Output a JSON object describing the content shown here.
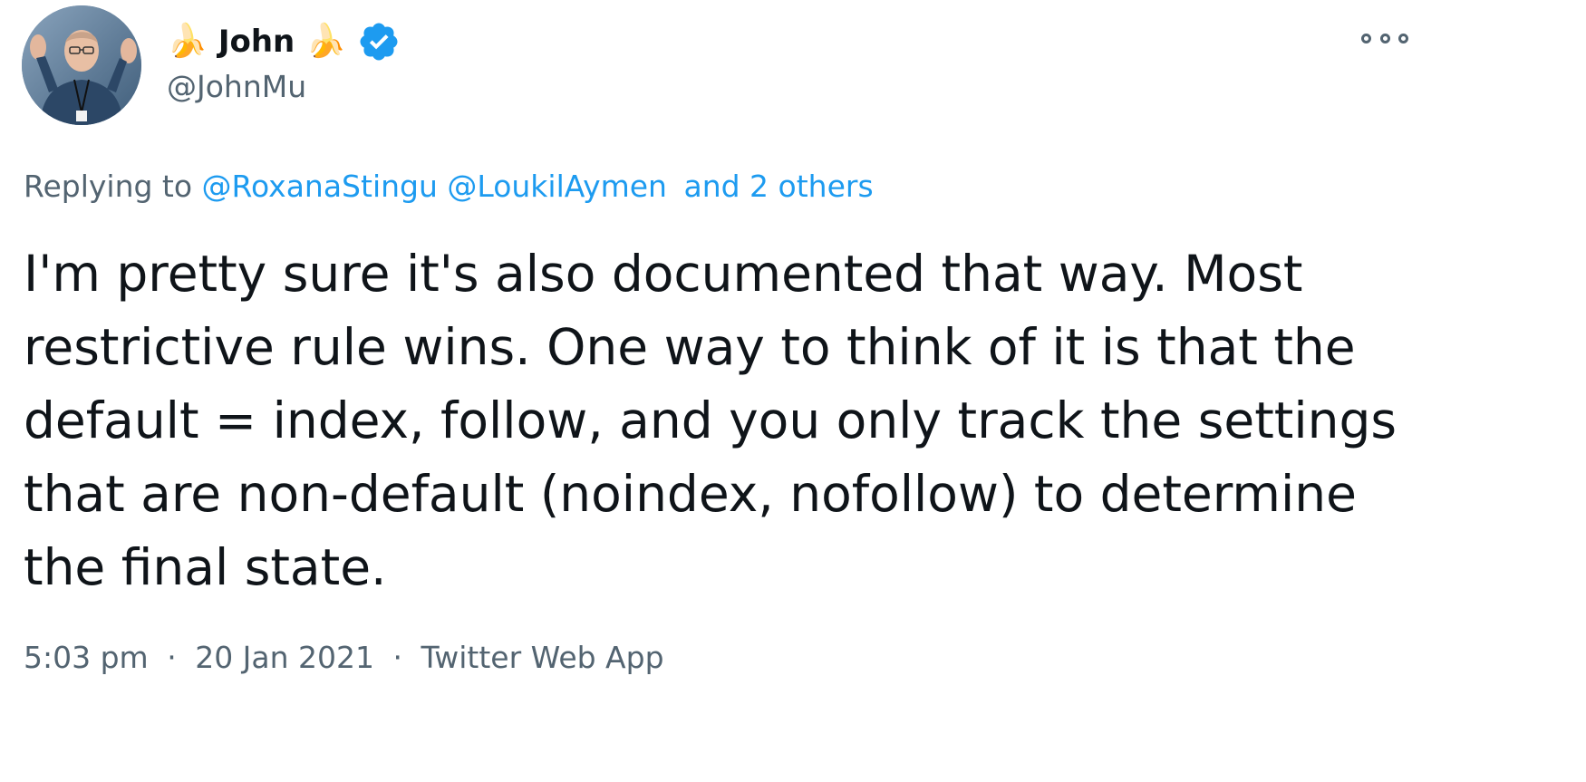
{
  "author": {
    "display_name": "John",
    "name_emoji": "🍌",
    "handle": "@JohnMu",
    "verified": true,
    "avatar_icon": "profile-photo"
  },
  "reply": {
    "prefix": "Replying to",
    "mentions": [
      "@RoxanaStingu",
      "@LoukilAymen"
    ],
    "others": "and 2 others"
  },
  "tweet": {
    "text": "I'm pretty sure it's also documented that way. Most restrictive rule wins. One way to think of it is that the default = index, follow, and you only track the settings that are non-default (noindex, nofollow) to determine the final state."
  },
  "meta": {
    "time": "5:03 pm",
    "date": "20 Jan 2021",
    "separator": "·",
    "source": "Twitter Web App"
  },
  "icons": {
    "more": "more-options-icon",
    "verified": "verified-badge-icon"
  },
  "colors": {
    "link": "#1d9bf0",
    "secondary_text": "#536471",
    "primary_text": "#0f1419",
    "verified": "#1d9bf0"
  }
}
